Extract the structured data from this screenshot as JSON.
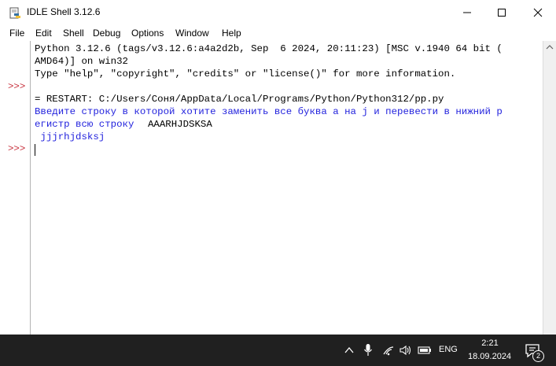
{
  "window": {
    "title": "IDLE Shell 3.12.6"
  },
  "menu": {
    "items": [
      "File",
      "Edit",
      "Shell",
      "Debug",
      "Options",
      "Window",
      "Help"
    ]
  },
  "shell": {
    "prompt": ">>>",
    "lines": [
      "Python 3.12.6 (tags/v3.12.6:a4a2d2b, Sep  6 2024, 20:11:23) [MSC v.1940 64 bit (",
      "AMD64)] on win32",
      "Type \"help\", \"copyright\", \"credits\" or \"license()\" for more information.",
      "= RESTART: C:/Users/Соня/AppData/Local/Programs/Python/Python312/pp.py",
      "Введите строку в которой хотите заменить все буква а на j и перевести в нижний р",
      "егистр всю строку ",
      "AAARHJDSKSA",
      " jjjrhjdsksj"
    ]
  },
  "taskbar": {
    "language": "ENG",
    "time": "2:21",
    "date": "18.09.2024",
    "notification_count": "2"
  },
  "colors": {
    "prompt": "#c7313d",
    "output_blue": "#2222dd",
    "taskbar": "#202020"
  }
}
